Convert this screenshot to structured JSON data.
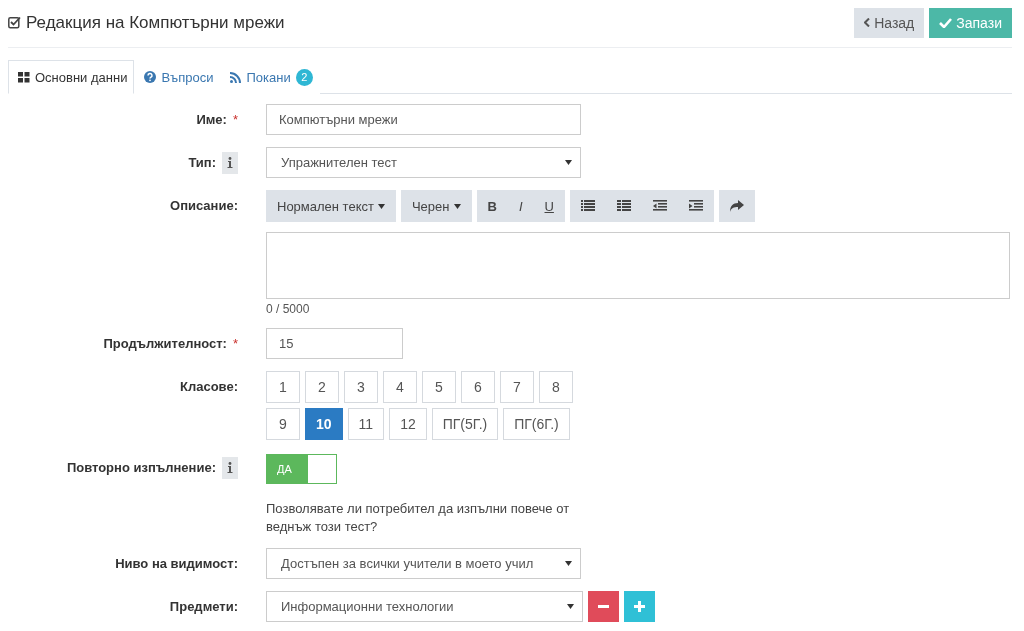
{
  "title": "Редакция на Компютърни мрежи",
  "buttons": {
    "back": "Назад",
    "save": "Запази"
  },
  "tabs": [
    {
      "label": "Основни данни",
      "selected": true,
      "kind": "grid"
    },
    {
      "label": "Въпроси",
      "selected": false,
      "kind": "help"
    },
    {
      "label": "Покани",
      "selected": false,
      "kind": "feed",
      "badge": "2"
    }
  ],
  "fields": [
    {
      "kind": "text",
      "label": "Име:",
      "required_mark": "*",
      "info": false,
      "value": "Компютърни мрежи"
    },
    {
      "kind": "select",
      "label": "Тип:",
      "info": true,
      "value": "Упражнителен тест"
    },
    {
      "kind": "editor",
      "label": "Описание:",
      "info": false,
      "dropdowns": [
        "Нормален текст",
        "Черен"
      ],
      "format_buttons": [
        "B",
        "I",
        "U"
      ],
      "counter": "0 / 5000"
    },
    {
      "kind": "short",
      "label": "Продължителност:",
      "required_mark": "*",
      "info": false,
      "value": "15"
    },
    {
      "kind": "grades",
      "label": "Класове:",
      "info": false,
      "grades": [
        {
          "label": "1",
          "selected": false
        },
        {
          "label": "2",
          "selected": false
        },
        {
          "label": "3",
          "selected": false
        },
        {
          "label": "4",
          "selected": false
        },
        {
          "label": "5",
          "selected": false
        },
        {
          "label": "6",
          "selected": false
        },
        {
          "label": "7",
          "selected": false
        },
        {
          "label": "8",
          "selected": false
        },
        {
          "label": "9",
          "selected": false
        },
        {
          "label": "10",
          "selected": true
        },
        {
          "label": "11",
          "selected": false
        },
        {
          "label": "12",
          "selected": false
        },
        {
          "label": "ПГ(5Г.)",
          "selected": false
        },
        {
          "label": "ПГ(6Г.)",
          "selected": false
        }
      ]
    },
    {
      "kind": "toggle",
      "label": "Повторно изпълнение:",
      "info": true,
      "on": true,
      "toggle_label": "ДА",
      "help": "Позволявате ли потребител да изпълни повече от веднъж този тест?"
    },
    {
      "kind": "select",
      "label": "Ниво на видимост:",
      "info": false,
      "value": "Достъпен за всички учители в моето учил"
    },
    {
      "kind": "subjects",
      "label": "Предмети:",
      "info": false,
      "value": "Информационни технологии"
    }
  ]
}
